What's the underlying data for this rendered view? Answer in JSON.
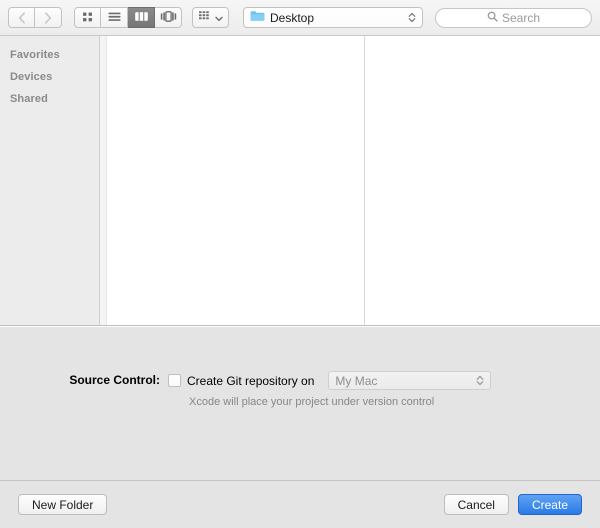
{
  "toolbar": {
    "back_label": "Back",
    "forward_label": "Forward",
    "view_icon_label": "Icon View",
    "view_list_label": "List View",
    "view_column_label": "Column View",
    "view_gallery_label": "Gallery View",
    "arrange_label": "Arrange By",
    "path": {
      "value": "Desktop",
      "icon": "folder-icon"
    },
    "search": {
      "placeholder": "Search",
      "value": "",
      "icon": "search-icon"
    }
  },
  "sidebar": {
    "sections": [
      {
        "label": "Favorites",
        "items": []
      },
      {
        "label": "Devices",
        "items": []
      },
      {
        "label": "Shared",
        "items": []
      }
    ]
  },
  "browser": {
    "columns": [
      {
        "items": []
      },
      {
        "items": []
      }
    ]
  },
  "accessory": {
    "source_control_label": "Source Control:",
    "git_checkbox": {
      "label": "Create Git repository on",
      "checked": false
    },
    "location_popup": {
      "value": "My Mac",
      "enabled": false
    },
    "hint": "Xcode will place your project under version control"
  },
  "bottom": {
    "new_folder_label": "New Folder",
    "cancel_label": "Cancel",
    "create_label": "Create"
  },
  "colors": {
    "accent": "#2a7be8",
    "folder": "#6fc3f0",
    "toolbar_bg": "#ececec",
    "panel_bg": "#e4e4e4",
    "sidebar_bg": "#ececec"
  }
}
